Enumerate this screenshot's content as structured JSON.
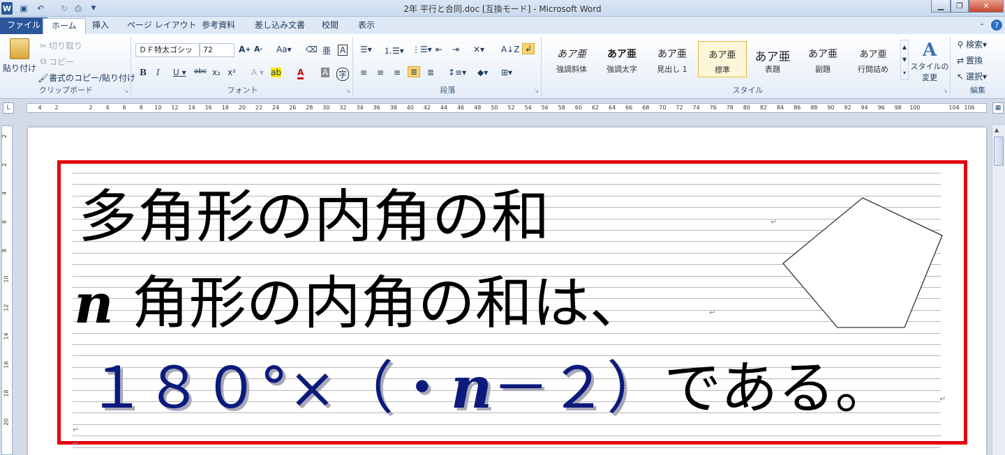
{
  "window": {
    "title": "2年 平行と合同.doc [互換モード] - Microsoft Word"
  },
  "tabs": [
    {
      "label": "ファイル"
    },
    {
      "label": "ホーム"
    },
    {
      "label": "挿入"
    },
    {
      "label": "ページ レイアウト"
    },
    {
      "label": "参考資料"
    },
    {
      "label": "差し込み文書"
    },
    {
      "label": "校閲"
    },
    {
      "label": "表示"
    }
  ],
  "clipboard": {
    "paste": "貼り付け",
    "cut": "切り取り",
    "copy": "コピー",
    "format_painter": "書式のコピー/貼り付け",
    "group": "クリップボード"
  },
  "font": {
    "name": "ＤＦ特太ゴシッ",
    "size": "72",
    "group": "フォント"
  },
  "paragraph": {
    "group": "段落"
  },
  "styles": {
    "group": "スタイル",
    "items": [
      {
        "preview": "あア亜",
        "name": "強調斜体"
      },
      {
        "preview": "あア亜",
        "name": "強調太字"
      },
      {
        "preview": "あア亜",
        "name": "見出し 1"
      },
      {
        "preview": "あア亜",
        "name": "標準"
      },
      {
        "preview": "あア亜",
        "name": "表題"
      },
      {
        "preview": "あア亜",
        "name": "副題"
      },
      {
        "preview": "あア亜",
        "name": "行間詰め"
      }
    ],
    "change": "スタイルの",
    "change2": "変更"
  },
  "editing": {
    "find": "検索",
    "replace": "置換",
    "select": "選択",
    "group": "編集"
  },
  "ruler": {
    "ticks": [
      "4",
      "2",
      "2",
      "4",
      "6",
      "8",
      "10",
      "12",
      "14",
      "16",
      "18",
      "20",
      "22",
      "24",
      "26",
      "28",
      "30",
      "32",
      "34",
      "36",
      "38",
      "40",
      "42",
      "44",
      "46",
      "48",
      "50",
      "52",
      "54",
      "56",
      "58",
      "60",
      "62",
      "64",
      "66",
      "68",
      "70",
      "72",
      "74",
      "76",
      "78",
      "80",
      "82",
      "84",
      "86",
      "88",
      "90",
      "92",
      "94",
      "96",
      "98",
      "100",
      "104",
      "106"
    ]
  },
  "vruler": {
    "ticks": [
      "2",
      "2",
      "4",
      "6",
      "8",
      "10",
      "12",
      "14",
      "16",
      "18",
      "20"
    ]
  },
  "document": {
    "line1": "多角形の内角の和",
    "line2_n": "n",
    "line2_rest": " 角形の内角の和は、",
    "line3_blue1": "１８０°×（・",
    "line3_n": "n",
    "line3_blue2": "－２）",
    "line3_black": "である。",
    "para_mark": "↵"
  },
  "colors": {
    "accent": "#2b579a",
    "red": "#e3000f",
    "blue": "#0c1a7c"
  }
}
